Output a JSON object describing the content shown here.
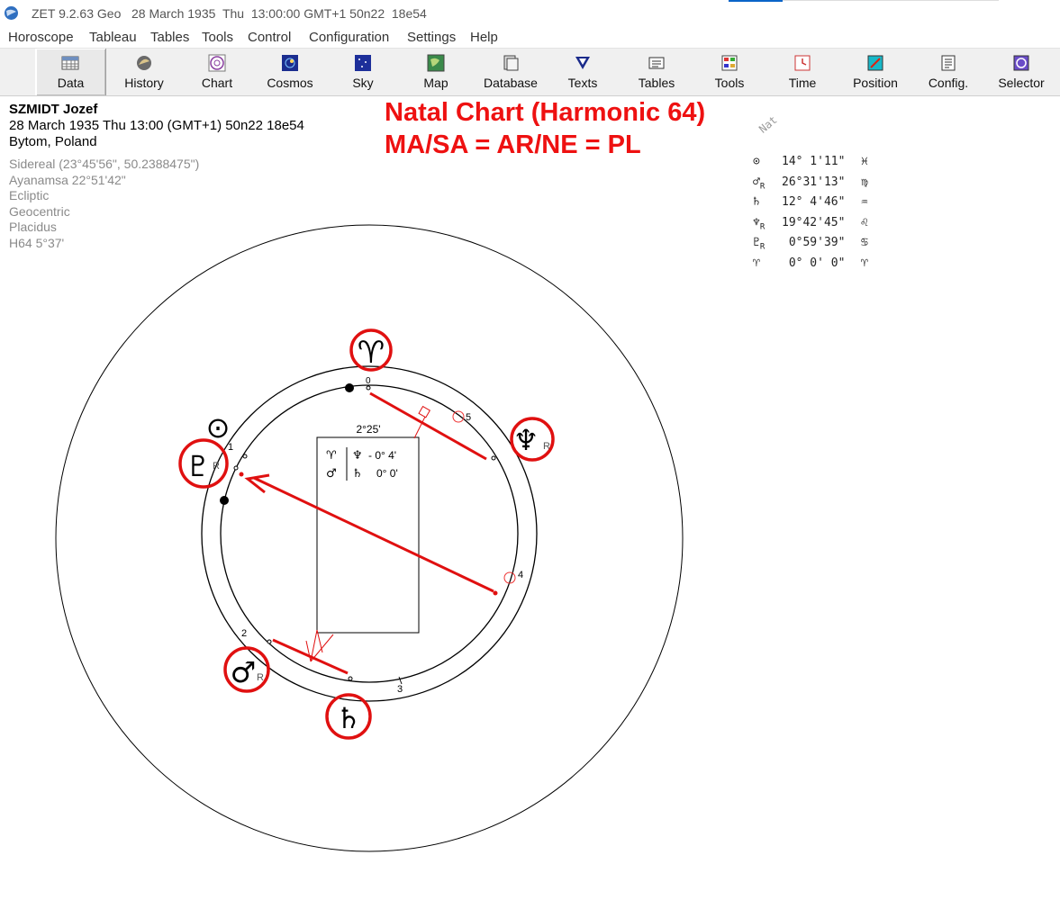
{
  "window": {
    "title": "ZET 9.2.63 Geo   28 March 1935  Thu  13:00:00 GMT+1 50n22  18e54"
  },
  "menu": {
    "items": [
      "Horoscope",
      "Tableau",
      "Tables",
      "Tools",
      "Control",
      "Configuration",
      "Settings",
      "Help"
    ]
  },
  "toolbar": {
    "buttons": [
      {
        "label": "Data",
        "icon": "table-icon",
        "active": true
      },
      {
        "label": "History",
        "icon": "history-icon"
      },
      {
        "label": "Chart",
        "icon": "chart-wheel-icon"
      },
      {
        "label": "Cosmos",
        "icon": "cosmos-icon"
      },
      {
        "label": "Sky",
        "icon": "sky-icon"
      },
      {
        "label": "Map",
        "icon": "map-icon"
      },
      {
        "label": "Database",
        "icon": "database-icon"
      },
      {
        "label": "Texts",
        "icon": "texts-icon"
      },
      {
        "label": "Tables",
        "icon": "tables-icon"
      },
      {
        "label": "Tools",
        "icon": "tools-icon"
      },
      {
        "label": "Time",
        "icon": "time-icon"
      },
      {
        "label": "Position",
        "icon": "position-icon"
      },
      {
        "label": "Config.",
        "icon": "config-icon"
      },
      {
        "label": "Selector",
        "icon": "selector-icon"
      }
    ]
  },
  "person": {
    "name": "SZMIDT Jozef",
    "datetime": "28 March 1935  Thu  13:00 (GMT+1) 50n22  18e54",
    "place": "Bytom, Poland"
  },
  "settings": {
    "zodiac": "Sidereal (23°45'56\", 50.2388475\")",
    "ayanamsa": "Ayanamsa 22°51'42\"",
    "coordinates": "Ecliptic",
    "center": "Geocentric",
    "houses": "Placidus",
    "harmonic": "H64   5°37'"
  },
  "annotation": {
    "title": "Natal Chart (Harmonic 64)",
    "formula": "MA/SA = AR/NE = PL",
    "color": "#ee1111"
  },
  "positions": {
    "label": "Nat",
    "rows": [
      {
        "glyph": "⊙",
        "retro": "",
        "value": "14° 1'11\"",
        "sign": "♓"
      },
      {
        "glyph": "♂",
        "retro": "R",
        "value": "26°31'13\"",
        "sign": "♍"
      },
      {
        "glyph": "♄",
        "retro": "",
        "value": "12° 4'46\"",
        "sign": "♒"
      },
      {
        "glyph": "♆",
        "retro": "R",
        "value": "19°42'45\"",
        "sign": "♌"
      },
      {
        "glyph": "♇",
        "retro": "R",
        "value": " 0°59'39\"",
        "sign": "♋"
      },
      {
        "glyph": "♈",
        "retro": "",
        "value": " 0° 0' 0\"",
        "sign": "♈"
      }
    ]
  },
  "chart": {
    "box_title": "2°25'",
    "box_rows": [
      {
        "left": "♈",
        "right": "♆",
        "value": "- 0° 4'"
      },
      {
        "left": "♂",
        "right": "♄",
        "value": "0° 0'"
      }
    ],
    "planet_labels": {
      "aries": "♈",
      "neptune": "♆",
      "neptune_retro": "R",
      "sun": "⊙",
      "pluto": "♇",
      "pluto_retro": "R",
      "mars": "♂",
      "mars_retro": "R",
      "saturn": "♄"
    },
    "house_numbers": [
      "5",
      "4",
      "3",
      "2",
      "1",
      "0"
    ]
  }
}
